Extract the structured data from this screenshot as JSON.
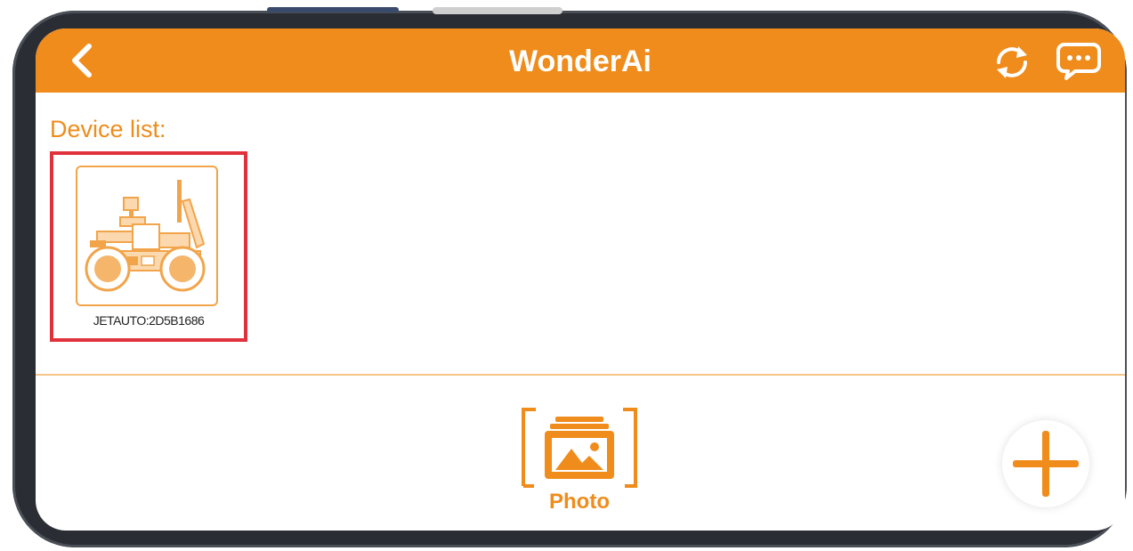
{
  "header": {
    "title": "WonderAi",
    "back_icon": "chevron-left-icon",
    "refresh_icon": "refresh-icon",
    "chat_icon": "chat-bubble-icon"
  },
  "device_list": {
    "label": "Device list:",
    "devices": [
      {
        "name": "JETAUTO:2D5B1686",
        "icon": "robot-vehicle-icon",
        "selected": true
      }
    ]
  },
  "bottom": {
    "photo_label": "Photo",
    "photo_icon": "photo-gallery-icon",
    "add_icon": "plus-icon"
  },
  "colors": {
    "accent": "#ef8c1c",
    "highlight": "#e0323c",
    "background": "#ffffff"
  }
}
